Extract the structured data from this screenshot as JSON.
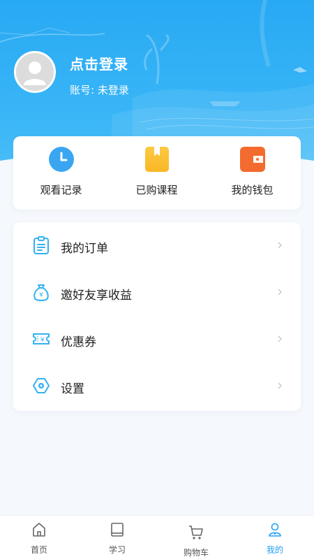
{
  "header": {
    "login_title": "点击登录",
    "account_label": "账号:",
    "account_value": "未登录"
  },
  "quick_actions": [
    {
      "label": "观看记录",
      "icon": "clock-icon",
      "color": "#3aa6f2"
    },
    {
      "label": "已购课程",
      "icon": "book-icon",
      "color": "#fbbf26"
    },
    {
      "label": "我的钱包",
      "icon": "wallet-icon",
      "color": "#f36b2e"
    }
  ],
  "menu": [
    {
      "label": "我的订单",
      "icon": "clipboard-icon"
    },
    {
      "label": "邀好友享收益",
      "icon": "money-bag-icon"
    },
    {
      "label": "优惠券",
      "icon": "coupon-icon"
    },
    {
      "label": "设置",
      "icon": "settings-icon"
    }
  ],
  "tabbar": [
    {
      "label": "首页",
      "icon": "home-icon"
    },
    {
      "label": "学习",
      "icon": "study-book-icon"
    },
    {
      "label": "购物车",
      "icon": "cart-icon"
    },
    {
      "label": "我的",
      "icon": "user-icon",
      "active": true
    }
  ],
  "colors": {
    "brand": "#2aaaf4",
    "accent_icon": "#34b1f1",
    "active_tab": "#1ea0f0"
  }
}
